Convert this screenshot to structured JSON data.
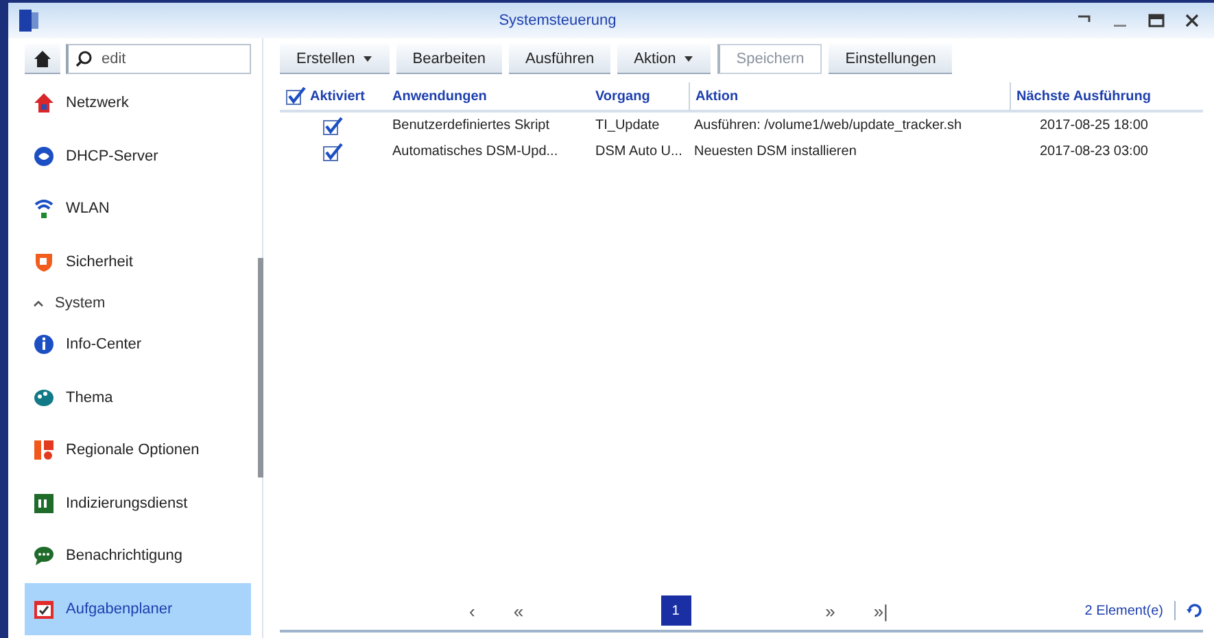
{
  "window": {
    "title": "Systemsteuerung"
  },
  "sidebar": {
    "search": {
      "value": "edit"
    },
    "items": [
      {
        "kind": "item",
        "label": "Netzwerk",
        "selected": false
      },
      {
        "kind": "item",
        "label": "DHCP-Server",
        "selected": false
      },
      {
        "kind": "item",
        "label": "WLAN",
        "selected": false
      },
      {
        "kind": "item",
        "label": "Sicherheit",
        "selected": false
      },
      {
        "kind": "section",
        "label": "System",
        "expanded": true
      },
      {
        "kind": "item",
        "label": "Info-Center",
        "selected": false
      },
      {
        "kind": "item",
        "label": "Thema",
        "selected": false
      },
      {
        "kind": "item",
        "label": "Regionale Optionen",
        "selected": false
      },
      {
        "kind": "item",
        "label": "Indizierungsdienst",
        "selected": false
      },
      {
        "kind": "item",
        "label": "Benachrichtigung",
        "selected": false
      },
      {
        "kind": "item",
        "label": "Aufgabenplaner",
        "selected": true
      }
    ]
  },
  "toolbar": [
    {
      "label": "Erstellen",
      "dropdown": true,
      "disabled": false
    },
    {
      "label": "Bearbeiten",
      "dropdown": false,
      "disabled": false
    },
    {
      "label": "Ausführen",
      "dropdown": false,
      "disabled": false
    },
    {
      "label": "Aktion",
      "dropdown": true,
      "disabled": false
    },
    {
      "label": "Speichern",
      "dropdown": false,
      "disabled": true
    },
    {
      "label": "Einstellungen",
      "dropdown": false,
      "disabled": false
    }
  ],
  "table": {
    "all_checked": true,
    "columns": [
      "Aktiviert",
      "Anwendungen",
      "Vorgang",
      "Aktion",
      "Nächste Ausführung"
    ],
    "rows": [
      {
        "checked": true,
        "cells": [
          "",
          "Benutzerdefiniertes Skript",
          "TI_Update",
          "Ausführen: /volume1/web/update_tracker.sh",
          "2017-08-25 18:00"
        ]
      },
      {
        "checked": true,
        "cells": [
          "",
          "Automatisches DSM-Upd...",
          "DSM Auto U...",
          "Neuesten DSM installieren",
          "2017-08-23 03:00"
        ]
      }
    ]
  },
  "pager": {
    "prev": "‹",
    "first": "«",
    "page": "1",
    "next": "»",
    "last": "»|",
    "count": "2 Element(e)"
  }
}
